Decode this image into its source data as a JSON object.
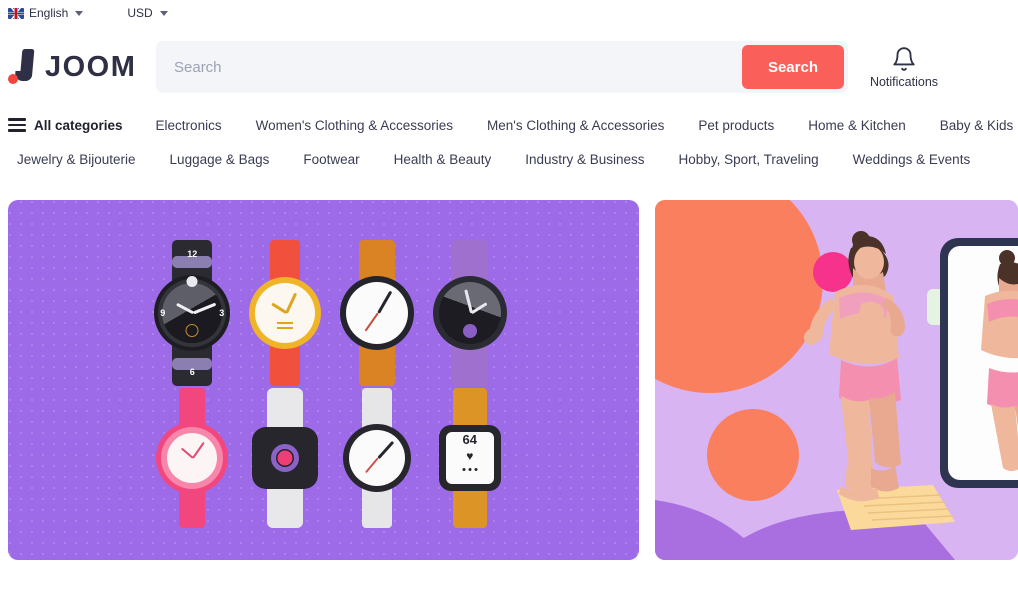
{
  "topbar": {
    "language": {
      "label": "English",
      "icon": "uk-flag-icon"
    },
    "currency": {
      "label": "USD"
    }
  },
  "header": {
    "logo_text": "JOOM",
    "search": {
      "placeholder": "Search",
      "value": "",
      "button_label": "Search"
    },
    "notifications": {
      "label": "Notifications",
      "icon": "bell-icon"
    }
  },
  "nav": {
    "all_categories_label": "All categories",
    "row1": [
      "Electronics",
      "Women's Clothing & Accessories",
      "Men's Clothing & Accessories",
      "Pet products",
      "Home & Kitchen",
      "Baby & Kids"
    ],
    "row2": [
      "Jewelry & Bijouterie",
      "Luggage & Bags",
      "Footwear",
      "Health & Beauty",
      "Industry & Business",
      "Hobby, Sport, Traveling",
      "Weddings & Events"
    ]
  },
  "banners": [
    {
      "name": "watches-banner",
      "background_color": "#9d6ae8",
      "theme": "watches",
      "watches": [
        {
          "name": "black-sport-watch",
          "numerals": [
            "12",
            "3",
            "6",
            "9"
          ]
        },
        {
          "name": "gold-classic-watch"
        },
        {
          "name": "brown-leather-watch"
        },
        {
          "name": "purple-chronograph-watch"
        },
        {
          "name": "pink-analog-watch"
        },
        {
          "name": "black-smartwatch"
        },
        {
          "name": "white-steel-watch"
        },
        {
          "name": "fitness-tracker-watch",
          "display_value": "64",
          "display_icon": "heart-icon"
        }
      ]
    },
    {
      "name": "fitness-banner",
      "background_color": "#d9b4f2",
      "theme": "fitness-mirror-selfie",
      "accent_color": "#fa7f5e",
      "highlight_color": "#f7328c"
    }
  ],
  "colors": {
    "accent": "#fa5f5a",
    "text": "#2f3146",
    "search_bg": "#f4f5f9",
    "banner_purple": "#9d6ae8",
    "banner_lilac": "#d9b4f2"
  }
}
